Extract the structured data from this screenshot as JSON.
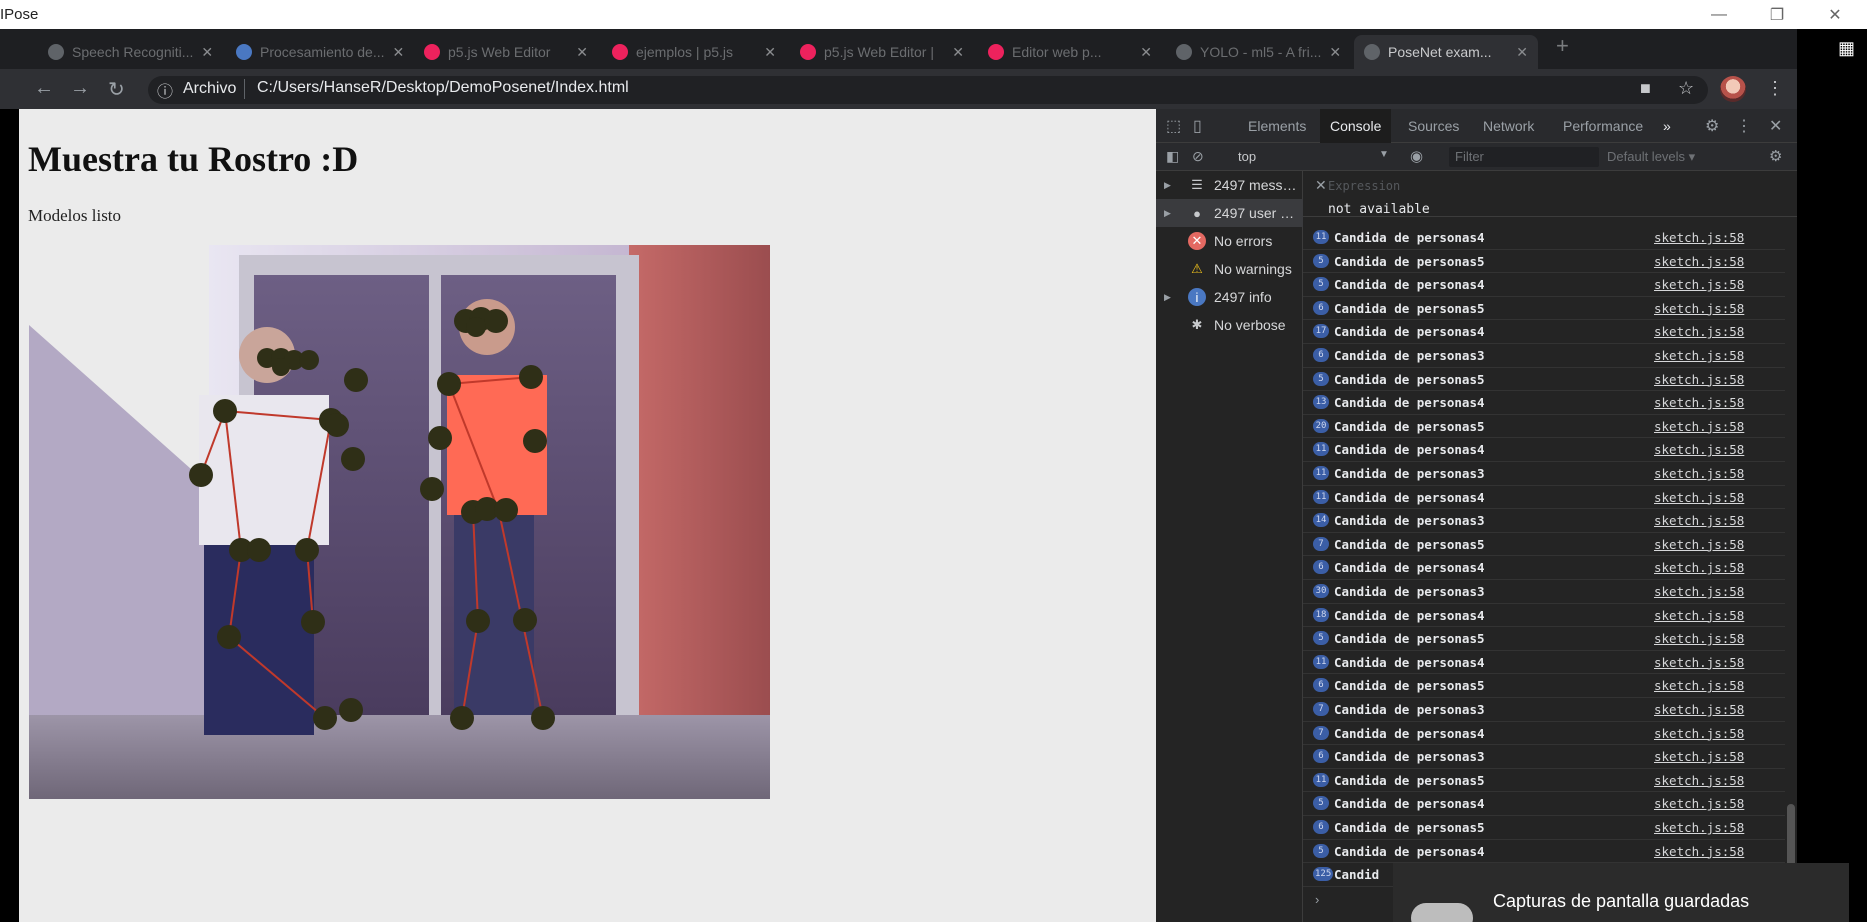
{
  "window": {
    "title": "IPose",
    "controls": {
      "minimize": "—",
      "restore": "❐",
      "close": "✕"
    }
  },
  "browser": {
    "tabs": [
      {
        "label": "Speech Recogniti...",
        "color": "#5f6368"
      },
      {
        "label": "Procesamiento de...",
        "color": "#4a78c2"
      },
      {
        "label": "p5.js Web Editor",
        "color": "#ed225d"
      },
      {
        "label": "ejemplos | p5.js",
        "color": "#ed225d"
      },
      {
        "label": "p5.js Web Editor |",
        "color": "#ed225d"
      },
      {
        "label": "Editor web p...",
        "color": "#ed225d"
      },
      {
        "label": "YOLO - ml5 - A fri...",
        "color": "#5f6368"
      },
      {
        "label": "PoseNet exam...",
        "color": "#5f6368"
      }
    ],
    "new_tab": "+",
    "address": {
      "scheme_label": "Archivo",
      "url": "C:/Users/HanseR/Desktop/DemoPosenet/Index.html"
    }
  },
  "page": {
    "heading": "Muestra tu Rostro :D",
    "status": "Modelos listo"
  },
  "devtools": {
    "tabs": [
      "Elements",
      "Console",
      "Sources",
      "Network",
      "Performance"
    ],
    "active_tab": "Console",
    "more_tabs": "»",
    "context": "top",
    "filter_placeholder": "Filter",
    "levels": "Default levels ▾",
    "sidebar": [
      {
        "label": "2497 messa...",
        "icon": "list-icon",
        "arrow": "▶"
      },
      {
        "label": "2497 user m...",
        "icon": "user-icon",
        "arrow": "▶"
      },
      {
        "label": "No errors",
        "icon": "error-icon",
        "arrow": ""
      },
      {
        "label": "No warnings",
        "icon": "warning-icon",
        "arrow": ""
      },
      {
        "label": "2497 info",
        "icon": "info-icon",
        "arrow": "▶"
      },
      {
        "label": "No verbose",
        "icon": "verbose-icon",
        "arrow": ""
      }
    ],
    "expression": {
      "close": "✕",
      "placeholder": "Expression",
      "value": "not available"
    },
    "messages": [
      {
        "count": "11",
        "text": "Candida de personas4",
        "source": "sketch.js:58"
      },
      {
        "count": "5",
        "text": "Candida de personas5",
        "source": "sketch.js:58"
      },
      {
        "count": "5",
        "text": "Candida de personas4",
        "source": "sketch.js:58"
      },
      {
        "count": "6",
        "text": "Candida de personas5",
        "source": "sketch.js:58"
      },
      {
        "count": "17",
        "text": "Candida de personas4",
        "source": "sketch.js:58"
      },
      {
        "count": "6",
        "text": "Candida de personas3",
        "source": "sketch.js:58"
      },
      {
        "count": "5",
        "text": "Candida de personas5",
        "source": "sketch.js:58"
      },
      {
        "count": "13",
        "text": "Candida de personas4",
        "source": "sketch.js:58"
      },
      {
        "count": "20",
        "text": "Candida de personas5",
        "source": "sketch.js:58"
      },
      {
        "count": "11",
        "text": "Candida de personas4",
        "source": "sketch.js:58"
      },
      {
        "count": "11",
        "text": "Candida de personas3",
        "source": "sketch.js:58"
      },
      {
        "count": "11",
        "text": "Candida de personas4",
        "source": "sketch.js:58"
      },
      {
        "count": "14",
        "text": "Candida de personas3",
        "source": "sketch.js:58"
      },
      {
        "count": "7",
        "text": "Candida de personas5",
        "source": "sketch.js:58"
      },
      {
        "count": "6",
        "text": "Candida de personas4",
        "source": "sketch.js:58"
      },
      {
        "count": "30",
        "text": "Candida de personas3",
        "source": "sketch.js:58"
      },
      {
        "count": "18",
        "text": "Candida de personas4",
        "source": "sketch.js:58"
      },
      {
        "count": "5",
        "text": "Candida de personas5",
        "source": "sketch.js:58"
      },
      {
        "count": "11",
        "text": "Candida de personas4",
        "source": "sketch.js:58"
      },
      {
        "count": "6",
        "text": "Candida de personas5",
        "source": "sketch.js:58"
      },
      {
        "count": "7",
        "text": "Candida de personas3",
        "source": "sketch.js:58"
      },
      {
        "count": "7",
        "text": "Candida de personas4",
        "source": "sketch.js:58"
      },
      {
        "count": "6",
        "text": "Candida de personas3",
        "source": "sketch.js:58"
      },
      {
        "count": "11",
        "text": "Candida de personas5",
        "source": "sketch.js:58"
      },
      {
        "count": "5",
        "text": "Candida de personas4",
        "source": "sketch.js:58"
      },
      {
        "count": "6",
        "text": "Candida de personas5",
        "source": "sketch.js:58"
      },
      {
        "count": "5",
        "text": "Candida de personas4",
        "source": "sketch.js:58"
      },
      {
        "count": "125",
        "text": "Candid",
        "source": ""
      }
    ]
  },
  "toast": {
    "title": "Capturas de pantalla guardadas"
  },
  "colors": {
    "console_badge": "#3b5ea6",
    "page_bg": "#ebebeb",
    "devtools_bg": "#242424"
  }
}
